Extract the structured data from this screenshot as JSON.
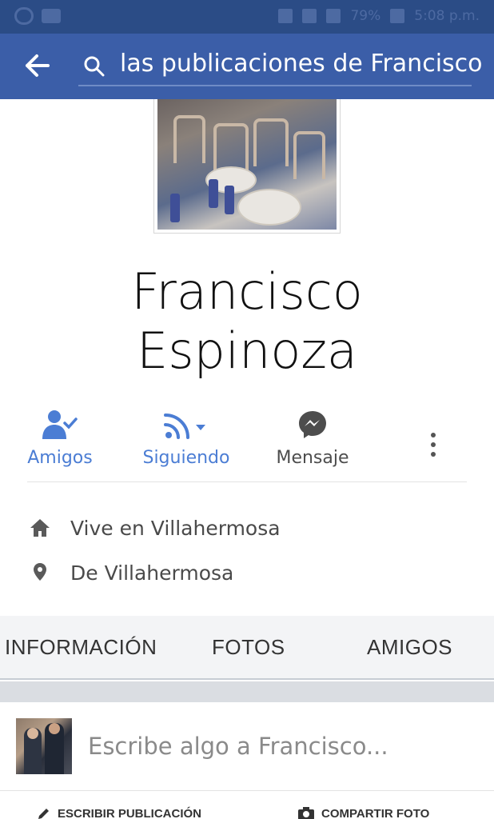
{
  "status_bar": {
    "battery": "79%",
    "time": "5:08 p.m."
  },
  "header": {
    "search_query": "las publicaciones de Francisco"
  },
  "profile": {
    "name_line1": "Francisco",
    "name_line2": "Espinoza"
  },
  "actions": {
    "friends_label": "Amigos",
    "following_label": "Siguiendo",
    "message_label": "Mensaje"
  },
  "colors": {
    "header_bg": "#3b5ea8",
    "accent": "#4b7dd4"
  },
  "info": {
    "lives": "Vive en Villahermosa",
    "from": "De Villahermosa"
  },
  "tabs": {
    "info": "INFORMACIÓN",
    "photos": "FOTOS",
    "friends": "AMIGOS"
  },
  "composer": {
    "placeholder": "Escribe algo a Francisco...",
    "write_post": "ESCRIBIR PUBLICACIÓN",
    "share_photo": "COMPARTIR FOTO"
  }
}
